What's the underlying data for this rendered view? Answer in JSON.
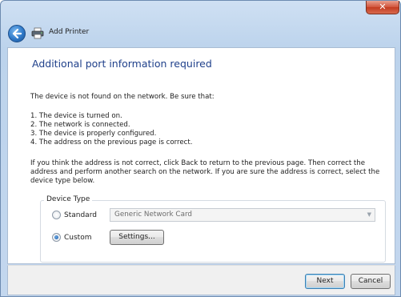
{
  "window": {
    "title": "Add Printer",
    "close_glyph": "✕"
  },
  "page": {
    "heading": "Additional port information required",
    "intro": "The device is not found on the network.  Be sure that:",
    "checklist": [
      "1.  The device is turned on.",
      "2.  The network is connected.",
      "3.  The device is properly configured.",
      "4.  The address on the previous page is correct."
    ],
    "advice": "If you think the address is not correct, click Back to return to the previous page.  Then correct the address and perform another search on the network.  If you are sure the address is correct, select the device type below."
  },
  "device_type": {
    "legend": "Device Type",
    "options": [
      {
        "label": "Standard",
        "selected": false
      },
      {
        "label": "Custom",
        "selected": true
      }
    ],
    "standard_combo_value": "Generic Network Card",
    "settings_button": "Settings..."
  },
  "footer": {
    "next_label": "Next",
    "cancel_label": "Cancel"
  },
  "icons": {
    "back": "back-arrow-icon",
    "printer": "printer-icon",
    "close": "close-icon",
    "dropdown": "chevron-down-icon"
  },
  "colors": {
    "heading": "#1e3f8a",
    "titlebar": "#c3d7ee",
    "close": "#c23b20"
  }
}
